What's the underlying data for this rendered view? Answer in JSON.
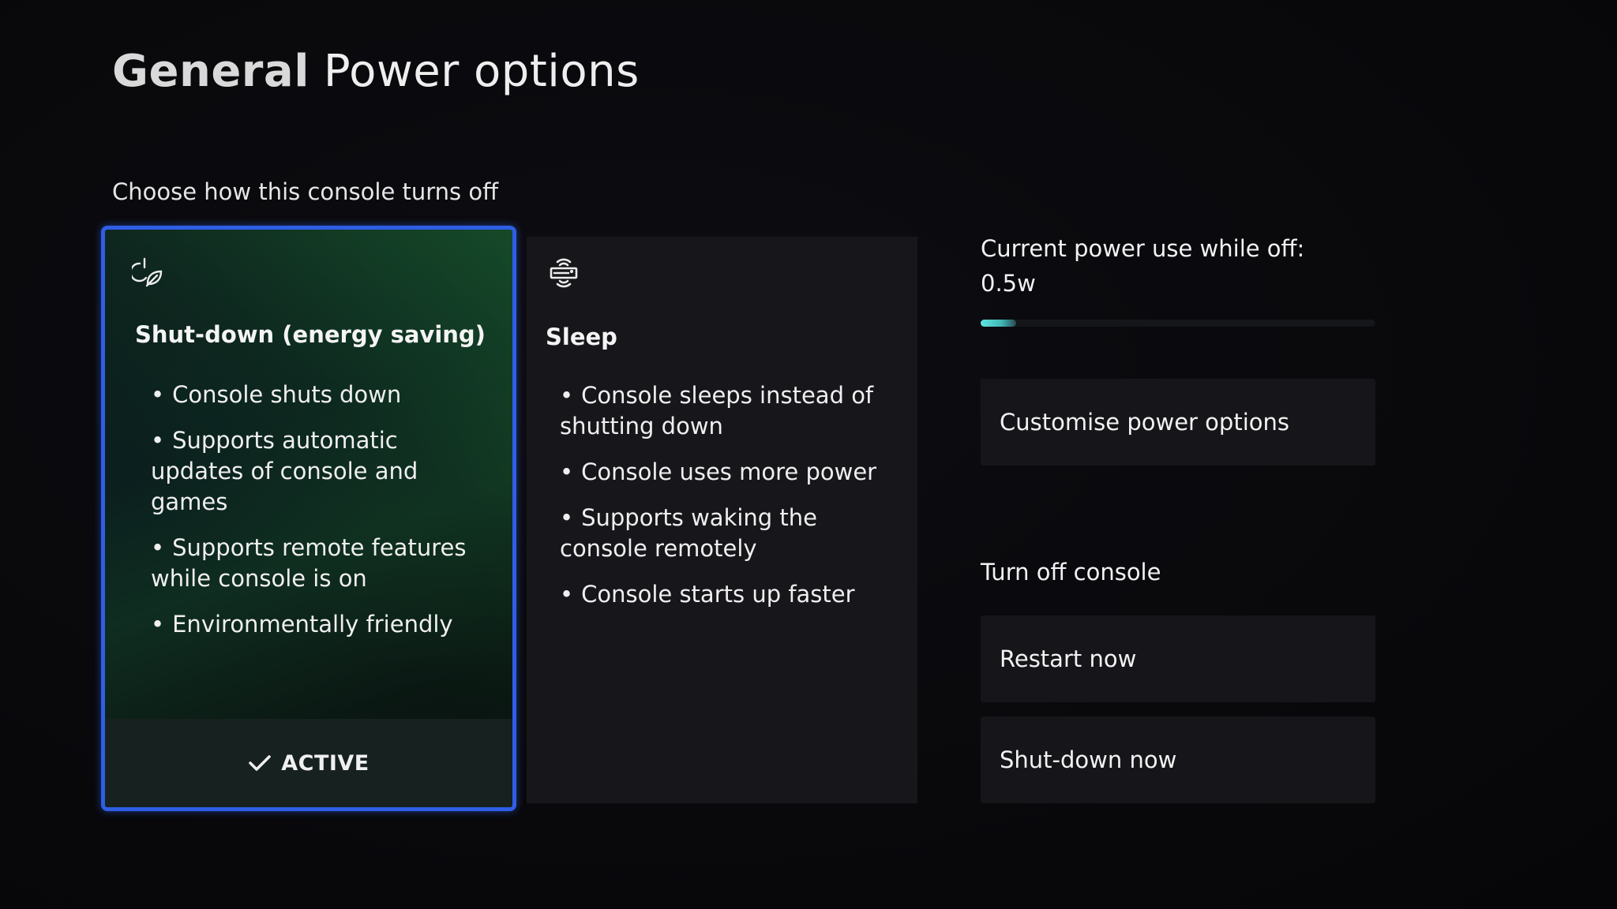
{
  "header": {
    "breadcrumb": "General",
    "title": "Power options"
  },
  "subtitle": "Choose how this console turns off",
  "modes": [
    {
      "icon": "power-leaf-icon",
      "title": "Shut-down (energy saving)",
      "bullets": [
        "Console shuts down",
        "Supports automatic updates of console and games",
        "Supports remote features while console is on",
        "Environmentally friendly"
      ],
      "selected": true,
      "status_label": "ACTIVE"
    },
    {
      "icon": "console-wireless-icon",
      "title": "Sleep",
      "bullets": [
        "Console sleeps instead of shutting down",
        "Console uses more power",
        "Supports waking the console remotely",
        "Console starts up faster"
      ],
      "selected": false
    }
  ],
  "power_use": {
    "label": "Current power use while off:",
    "value": "0.5w",
    "meter_fraction": 0.09
  },
  "buttons": {
    "customise": "Customise power options"
  },
  "turn_off": {
    "label": "Turn off console",
    "restart": "Restart now",
    "shutdown": "Shut-down now"
  },
  "colors": {
    "focus_border": "#2f5ee6",
    "meter_fill": "#5fe6e0"
  },
  "bullet_glyph": "•"
}
